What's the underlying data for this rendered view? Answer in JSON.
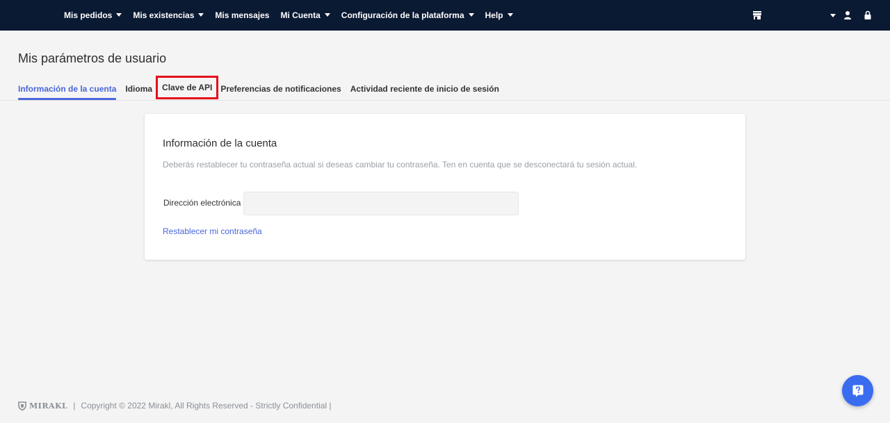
{
  "nav": {
    "items": [
      {
        "label": "Mis pedidos",
        "dropdown": true
      },
      {
        "label": "Mis existencias",
        "dropdown": true
      },
      {
        "label": "Mis mensajes",
        "dropdown": false
      },
      {
        "label": "Mi Cuenta",
        "dropdown": true
      },
      {
        "label": "Configuración de la plataforma",
        "dropdown": true
      },
      {
        "label": "Help",
        "dropdown": true
      }
    ],
    "right_icons": [
      "store-icon",
      "chevron-down-icon",
      "user-icon",
      "lock-icon"
    ],
    "background": "#0b1a33"
  },
  "page": {
    "title": "Mis parámetros de usuario",
    "tabs": [
      {
        "label": "Información de la cuenta",
        "active": true
      },
      {
        "label": "Idioma"
      },
      {
        "label": "Clave de API",
        "highlighted": true
      },
      {
        "label": "Preferencias de notificaciones"
      },
      {
        "label": "Actividad reciente de inicio de sesión"
      }
    ]
  },
  "card": {
    "title": "Información de la cuenta",
    "description": "Deberás restablecer tu contraseña actual si deseas cambiar tu contraseña. Ten en cuenta que se desconectará tu sesión actual.",
    "email_label": "Dirección electrónica",
    "email_value": "",
    "reset_link": "Restablecer mi contraseña"
  },
  "footer": {
    "brand": "MIRAKL",
    "separator": "|",
    "copyright": "Copyright © 2022 Mirakl, All Rights Reserved - Strictly Confidential |"
  },
  "colors": {
    "accent": "#4a66db",
    "highlight": "#e3101a",
    "fab": "#3a6cf0"
  }
}
